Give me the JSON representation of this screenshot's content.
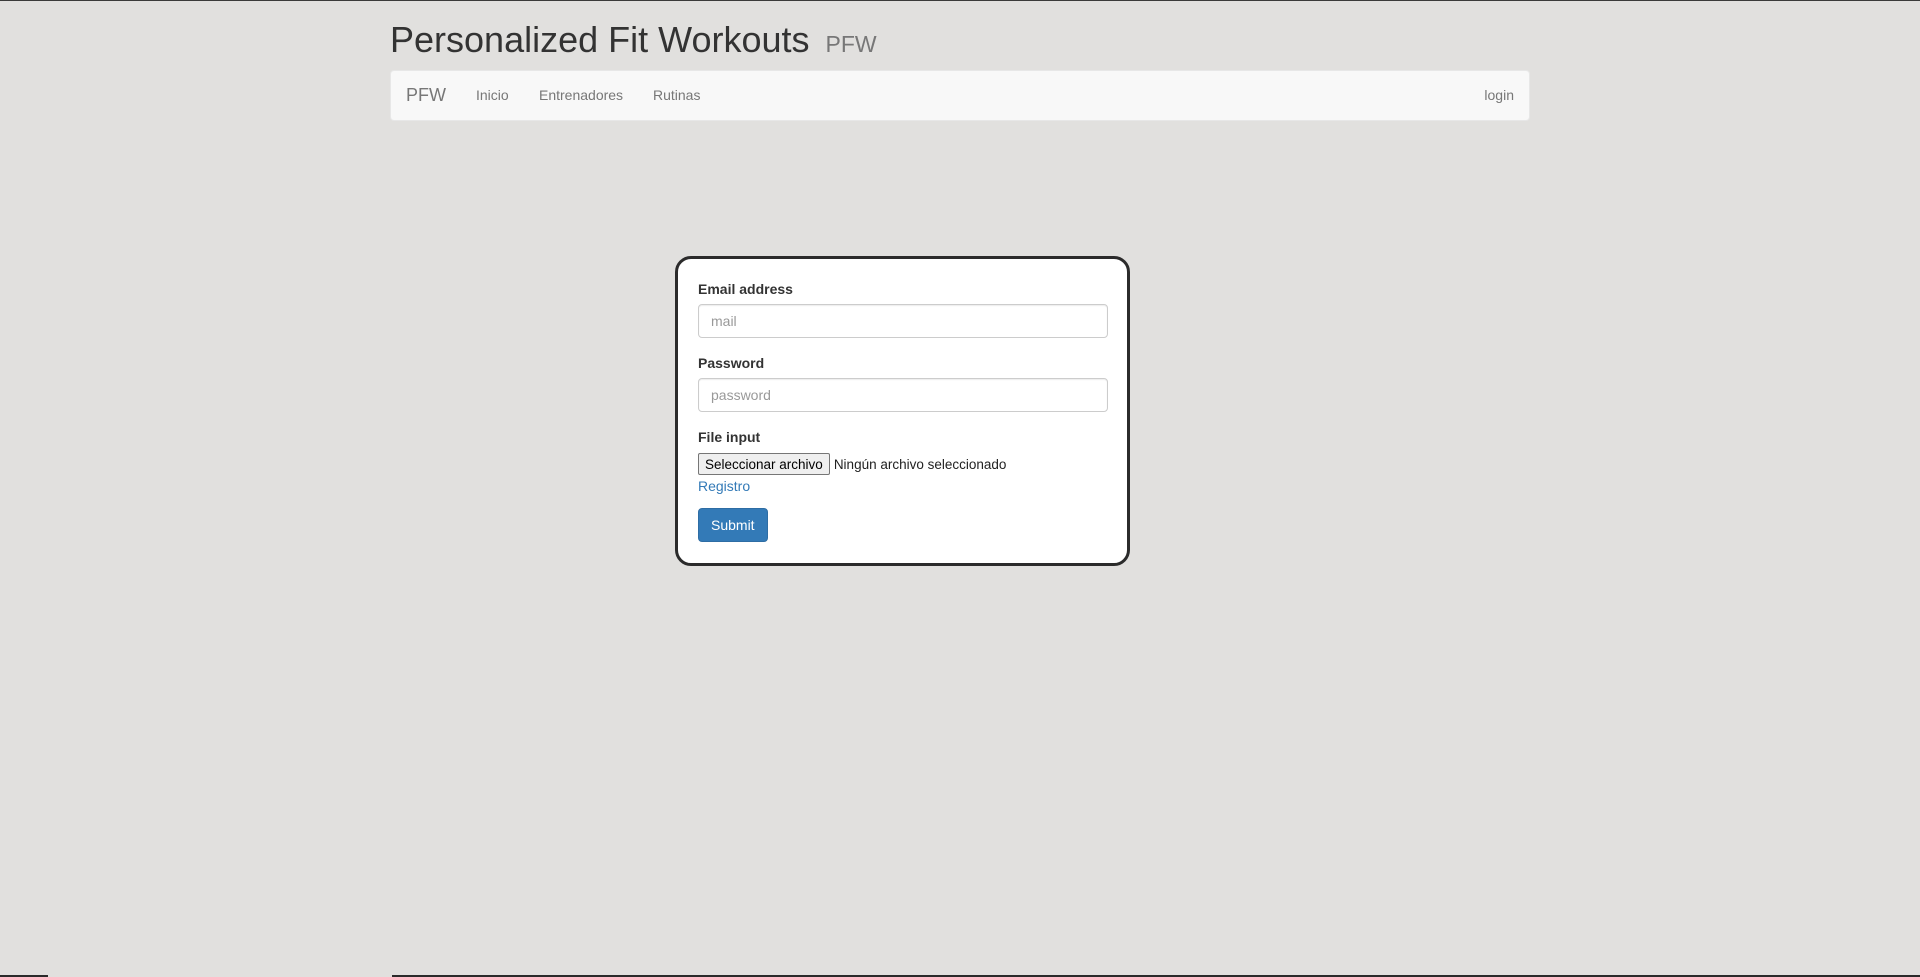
{
  "header": {
    "title": "Personalized Fit Workouts",
    "subtitle": "PFW"
  },
  "navbar": {
    "brand": "PFW",
    "links": [
      {
        "label": "Inicio"
      },
      {
        "label": "Entrenadores"
      },
      {
        "label": "Rutinas"
      }
    ],
    "login_label": "login"
  },
  "form": {
    "email_label": "Email address",
    "email_placeholder": "mail",
    "email_value": "",
    "password_label": "Password",
    "password_placeholder": "password",
    "password_value": "",
    "file_label": "File input",
    "file_button_label": "Seleccionar archivo",
    "file_status": "Ningún archivo seleccionado",
    "register_link": "Registro",
    "submit_label": "Submit"
  },
  "colors": {
    "page_background": "#e1e0de",
    "navbar_background": "#f8f8f8",
    "primary_button": "#337ab7",
    "link": "#337ab7",
    "card_border": "#2b2b2b"
  }
}
